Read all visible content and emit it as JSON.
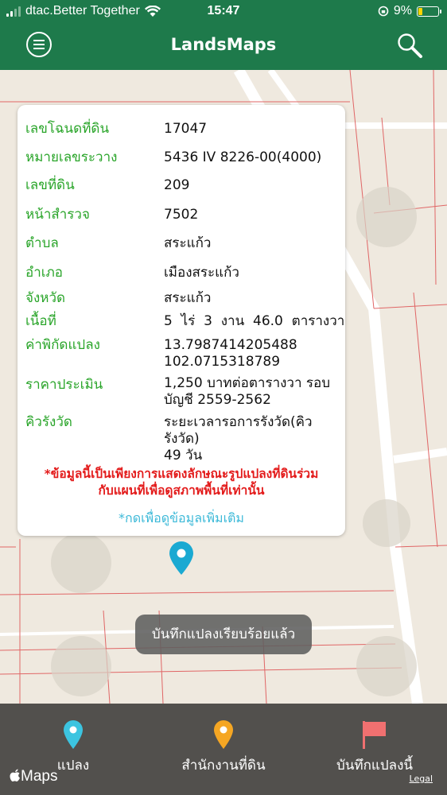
{
  "status_bar": {
    "carrier": "dtac.Better Together",
    "time": "15:47",
    "battery": "9%"
  },
  "navbar": {
    "title": "LandsMaps"
  },
  "parcel_info": {
    "rows": [
      {
        "label": "เลขโฉนดที่ดิน",
        "value": "17047"
      },
      {
        "label": "หมายเลขระวาง",
        "value": "5436 IV 8226-00(4000)"
      },
      {
        "label": "เลขที่ดิน",
        "value": "209"
      },
      {
        "label": "หน้าสำรวจ",
        "value": "7502"
      },
      {
        "label": "ตำบล",
        "value": "สระแก้ว"
      },
      {
        "label": "อำเภอ",
        "value": "เมืองสระแก้ว"
      },
      {
        "label": "จังหวัด",
        "value": "สระแก้ว"
      },
      {
        "label": "เนื้อที่",
        "value": "5  ไร่  3  งาน  46.0  ตารางวา"
      },
      {
        "label": "ค่าพิกัดแปลง",
        "value_line1": "13.7987414205488",
        "value_line2": "102.0715318789"
      },
      {
        "label": "ราคาประเมิน",
        "value_line1": "1,250 บาทต่อตารางวา รอบ",
        "value_line2": "บัญชี 2559-2562"
      },
      {
        "label": "คิวรังวัด",
        "value_line1": "ระยะเวลารอการรังวัด(คิวรังวัด)",
        "value_line2": "49 วัน"
      }
    ],
    "warning_line1": "*ข้อมูลนี้เป็นเพียงการแสดงลักษณะรูปแปลงที่ดินร่วม",
    "warning_line2": "กับแผนที่เพื่อดูสภาพพื้นที่เท่านั้น",
    "more_link": "*กดเพื่อดูข้อมูลเพิ่มเติม"
  },
  "toast": "บันทึกแปลงเรียบร้อยแล้ว",
  "tabbar": {
    "tabs": [
      {
        "label": "แปลง",
        "icon": "map-pin-icon",
        "color": "#3cc4e0"
      },
      {
        "label": "สำนักงานที่ดิน",
        "icon": "map-pin-icon",
        "color": "#f5a623"
      },
      {
        "label": "บันทึกแปลงนี้",
        "icon": "flag-icon",
        "color": "#f07070"
      }
    ]
  },
  "map_attribution": {
    "logo": "Maps",
    "legal": "Legal"
  },
  "colors": {
    "header_green": "#1e7a4b",
    "label_green": "#2aa52a",
    "warning_red": "#e31b1b",
    "link_blue": "#3cb9d8",
    "pin_blue": "#1aa9d2"
  }
}
